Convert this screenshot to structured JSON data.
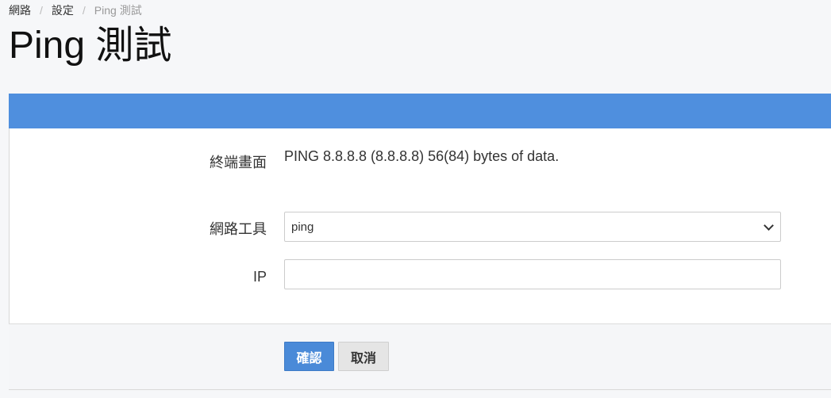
{
  "breadcrumb": {
    "items": [
      "網路",
      "設定",
      "Ping 測試"
    ],
    "separator": "/"
  },
  "page": {
    "title": "Ping 測試"
  },
  "form": {
    "terminal": {
      "label": "終端畫面",
      "output": "PING 8.8.8.8 (8.8.8.8) 56(84) bytes of data."
    },
    "tool": {
      "label": "網路工具",
      "selected": "ping"
    },
    "ip": {
      "label": "IP",
      "value": "",
      "placeholder": ""
    }
  },
  "actions": {
    "confirm_label": "確認",
    "cancel_label": "取消"
  },
  "colors": {
    "header": "#4f8fde",
    "primary_button": "#4a8ad8",
    "background": "#f6f7f9"
  }
}
